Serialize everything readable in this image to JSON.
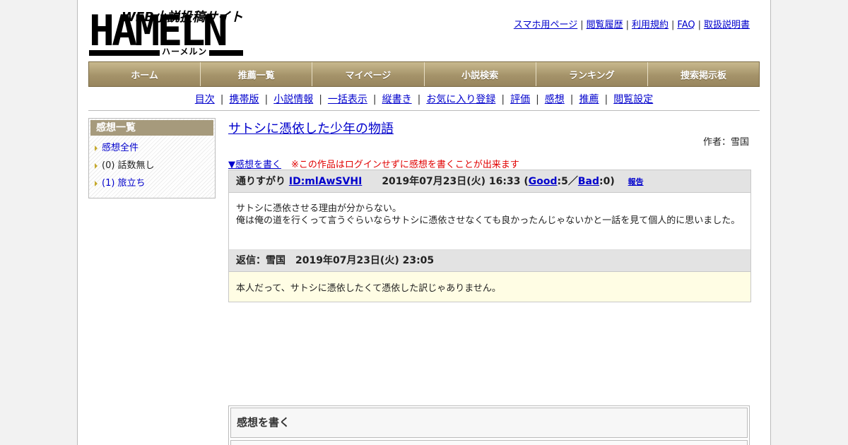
{
  "logo": {
    "tagline": "WEB小説投稿サイト",
    "wordmark": "HAMELN",
    "kana": "ハーメルン"
  },
  "top_links": [
    "スマホ用ページ",
    "閲覧履歴",
    "利用規約",
    "FAQ",
    "取扱説明書"
  ],
  "main_nav": [
    "ホーム",
    "推薦一覧",
    "マイページ",
    "小説検索",
    "ランキング",
    "捜索掲示板"
  ],
  "sub_nav": [
    "目次",
    "携帯版",
    "小説情報",
    "一括表示",
    "縦書き",
    "お気に入り登録",
    "評価",
    "感想",
    "推薦",
    "閲覧設定"
  ],
  "sidebar": {
    "title": "感想一覧",
    "items": [
      {
        "label": "感想全件",
        "link": true
      },
      {
        "label": "(0) 話数無し",
        "link": false
      },
      {
        "label": "(1) 旅立ち",
        "link": true
      }
    ]
  },
  "novel": {
    "title": "サトシに憑依した少年の物語",
    "author": "作者：雪国"
  },
  "write_review": {
    "link": "▼感想を書く",
    "warning": "※この作品はログインせずに感想を書くことが出来ます"
  },
  "review": {
    "name": "通りすがり",
    "id": "ID:mlAwSVHI",
    "date": "2019年07月23日(火) 16:33",
    "open": "(",
    "good_label": "Good",
    "good_count": ":5／",
    "bad_label": "Bad",
    "bad_count": ":0)",
    "report": "報告",
    "body_line1": "サトシに憑依させる理由が分からない。",
    "body_line2": "俺は俺の道を行くって言うぐらいならサトシに憑依させなくても良かったんじゃないかと一話を見て個人的に思いました。",
    "reply_head": "返信：雪国　2019年07月23日(火) 23:05",
    "reply_body": "本人だって、サトシに憑依したくて憑依した訳じゃありません。"
  },
  "write_box": {
    "title": "感想を書く"
  },
  "colors": {
    "nav_gold": "#a5936a",
    "link": "#0000cc",
    "warning": "#e00000",
    "reply_bg": "#fffde4"
  }
}
